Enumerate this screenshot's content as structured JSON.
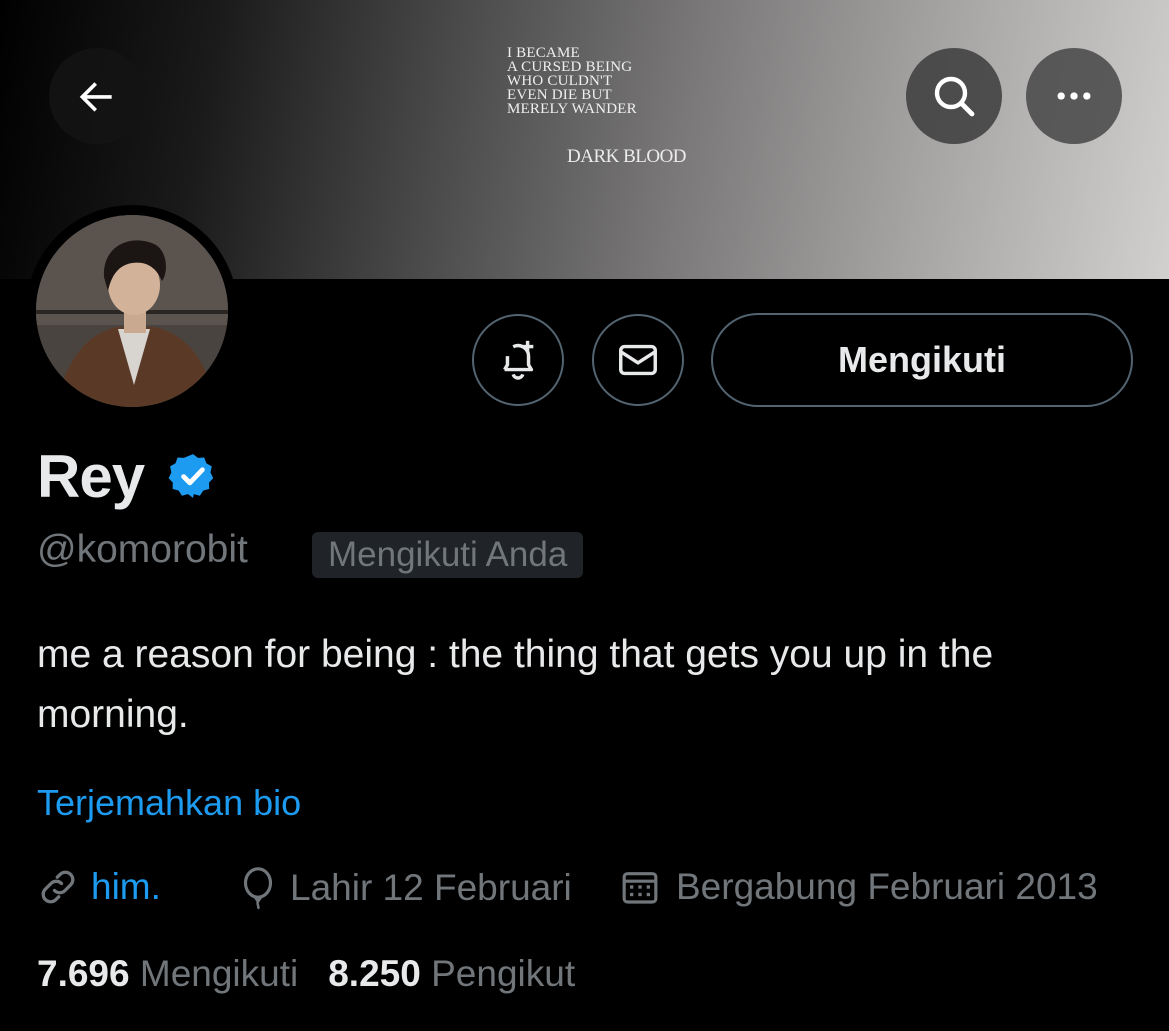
{
  "header": {
    "banner_quote": "I BECAME\nA CURSED BEING\nWHO CULDN'T\nEVEN DIE BUT\nMERELY WANDER",
    "banner_brand": "DARK BLOOD",
    "back_icon": "arrow-left-icon",
    "search_icon": "search-icon",
    "more_icon": "more-horizontal-icon"
  },
  "actions": {
    "notify_icon": "bell-plus-icon",
    "dm_icon": "envelope-icon",
    "follow_label": "Mengikuti"
  },
  "profile": {
    "display_name": "Rey",
    "verified": true,
    "handle": "@komorobit",
    "follows_you": "Mengikuti Anda",
    "bio": "me a reason for being : the thing that gets you up in the morning.",
    "translate_label": "Terjemahkan bio",
    "link_text": "him.",
    "birthday": "Lahir 12 Februari",
    "joined": "Bergabung Februari 2013"
  },
  "stats": {
    "following_count": "7.696",
    "following_label": "Mengikuti",
    "followers_count": "8.250",
    "followers_label": "Pengikut"
  },
  "colors": {
    "background": "#000000",
    "accent": "#1d9bf0",
    "primary_text": "#e7e9ea",
    "secondary_text": "#71767b",
    "border": "#536471"
  }
}
